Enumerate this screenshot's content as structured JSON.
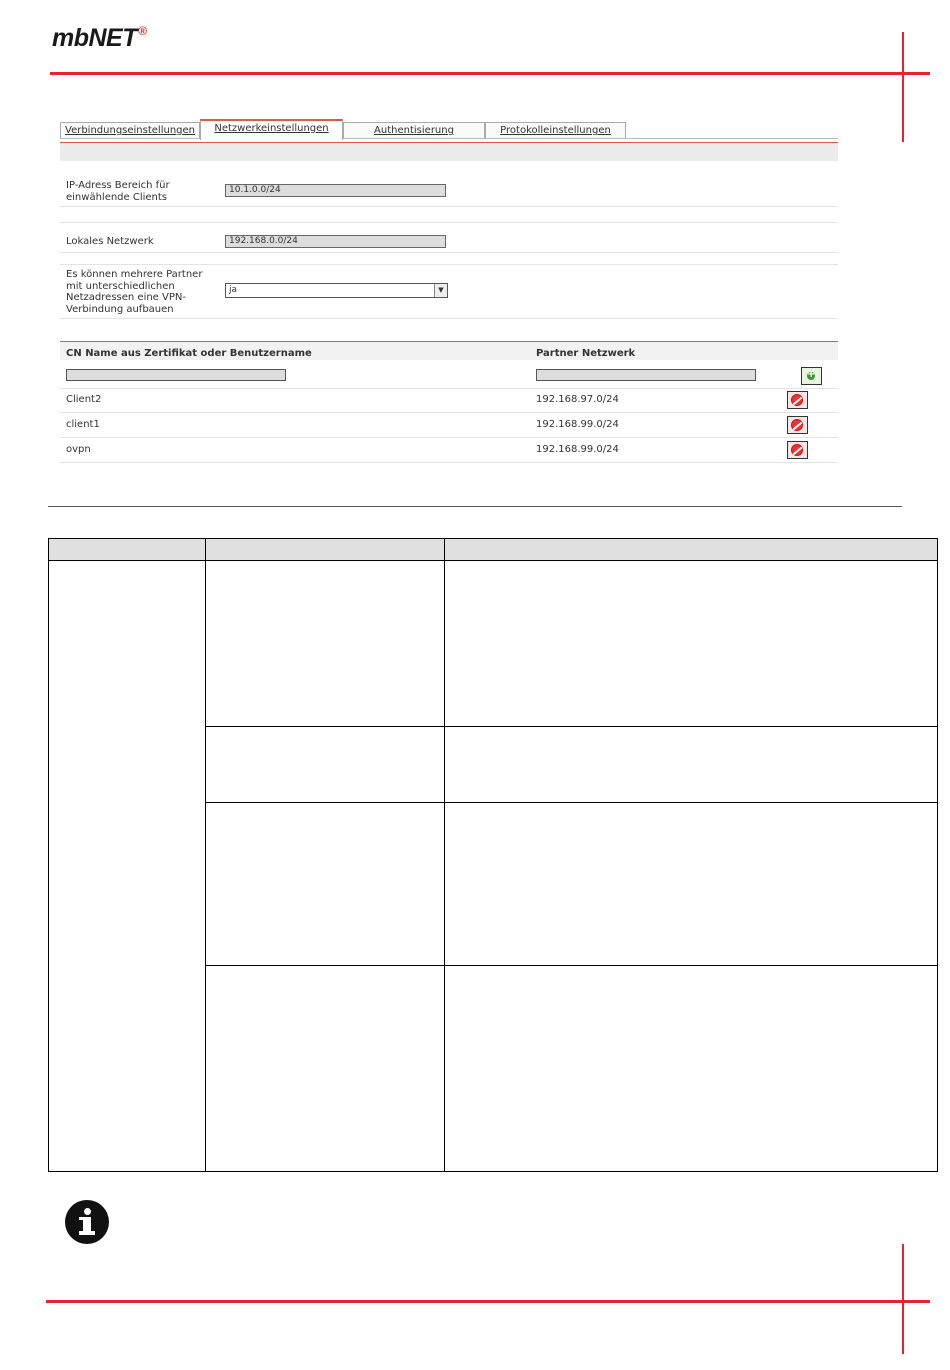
{
  "header": {
    "logo_text": "mbNET",
    "logo_mark": "®",
    "accent_color": "#e3262d"
  },
  "tabs": [
    {
      "label": "Verbindungseinstellungen",
      "active": false
    },
    {
      "label": "Netzwerkeinstellungen",
      "active": true
    },
    {
      "label": "Authentisierung",
      "active": false
    },
    {
      "label": "Protokolleinstellungen",
      "active": false
    }
  ],
  "form": {
    "ip_range": {
      "label": "IP-Adress Bereich für einwählende Clients",
      "value": "10.1.0.0/24"
    },
    "local_network": {
      "label": "Lokales Netzwerk",
      "value": "192.168.0.0/24"
    },
    "multi_partner": {
      "label": "Es können mehrere Partner mit unterschiedlichen Netzadressen eine VPN-Verbindung aufbauen",
      "value": "ja"
    }
  },
  "partners_table": {
    "headers": {
      "cn_name": "CN Name aus Zertifikat oder Benutzername",
      "partner_network": "Partner Netzwerk"
    },
    "rows": [
      {
        "name": "Client2",
        "network": "192.168.97.0/24"
      },
      {
        "name": "client1",
        "network": "192.168.99.0/24"
      },
      {
        "name": "ovpn",
        "network": "192.168.99.0/24"
      }
    ]
  },
  "icons": {
    "add": "add-icon",
    "delete": "delete-icon",
    "info": "info-icon"
  }
}
